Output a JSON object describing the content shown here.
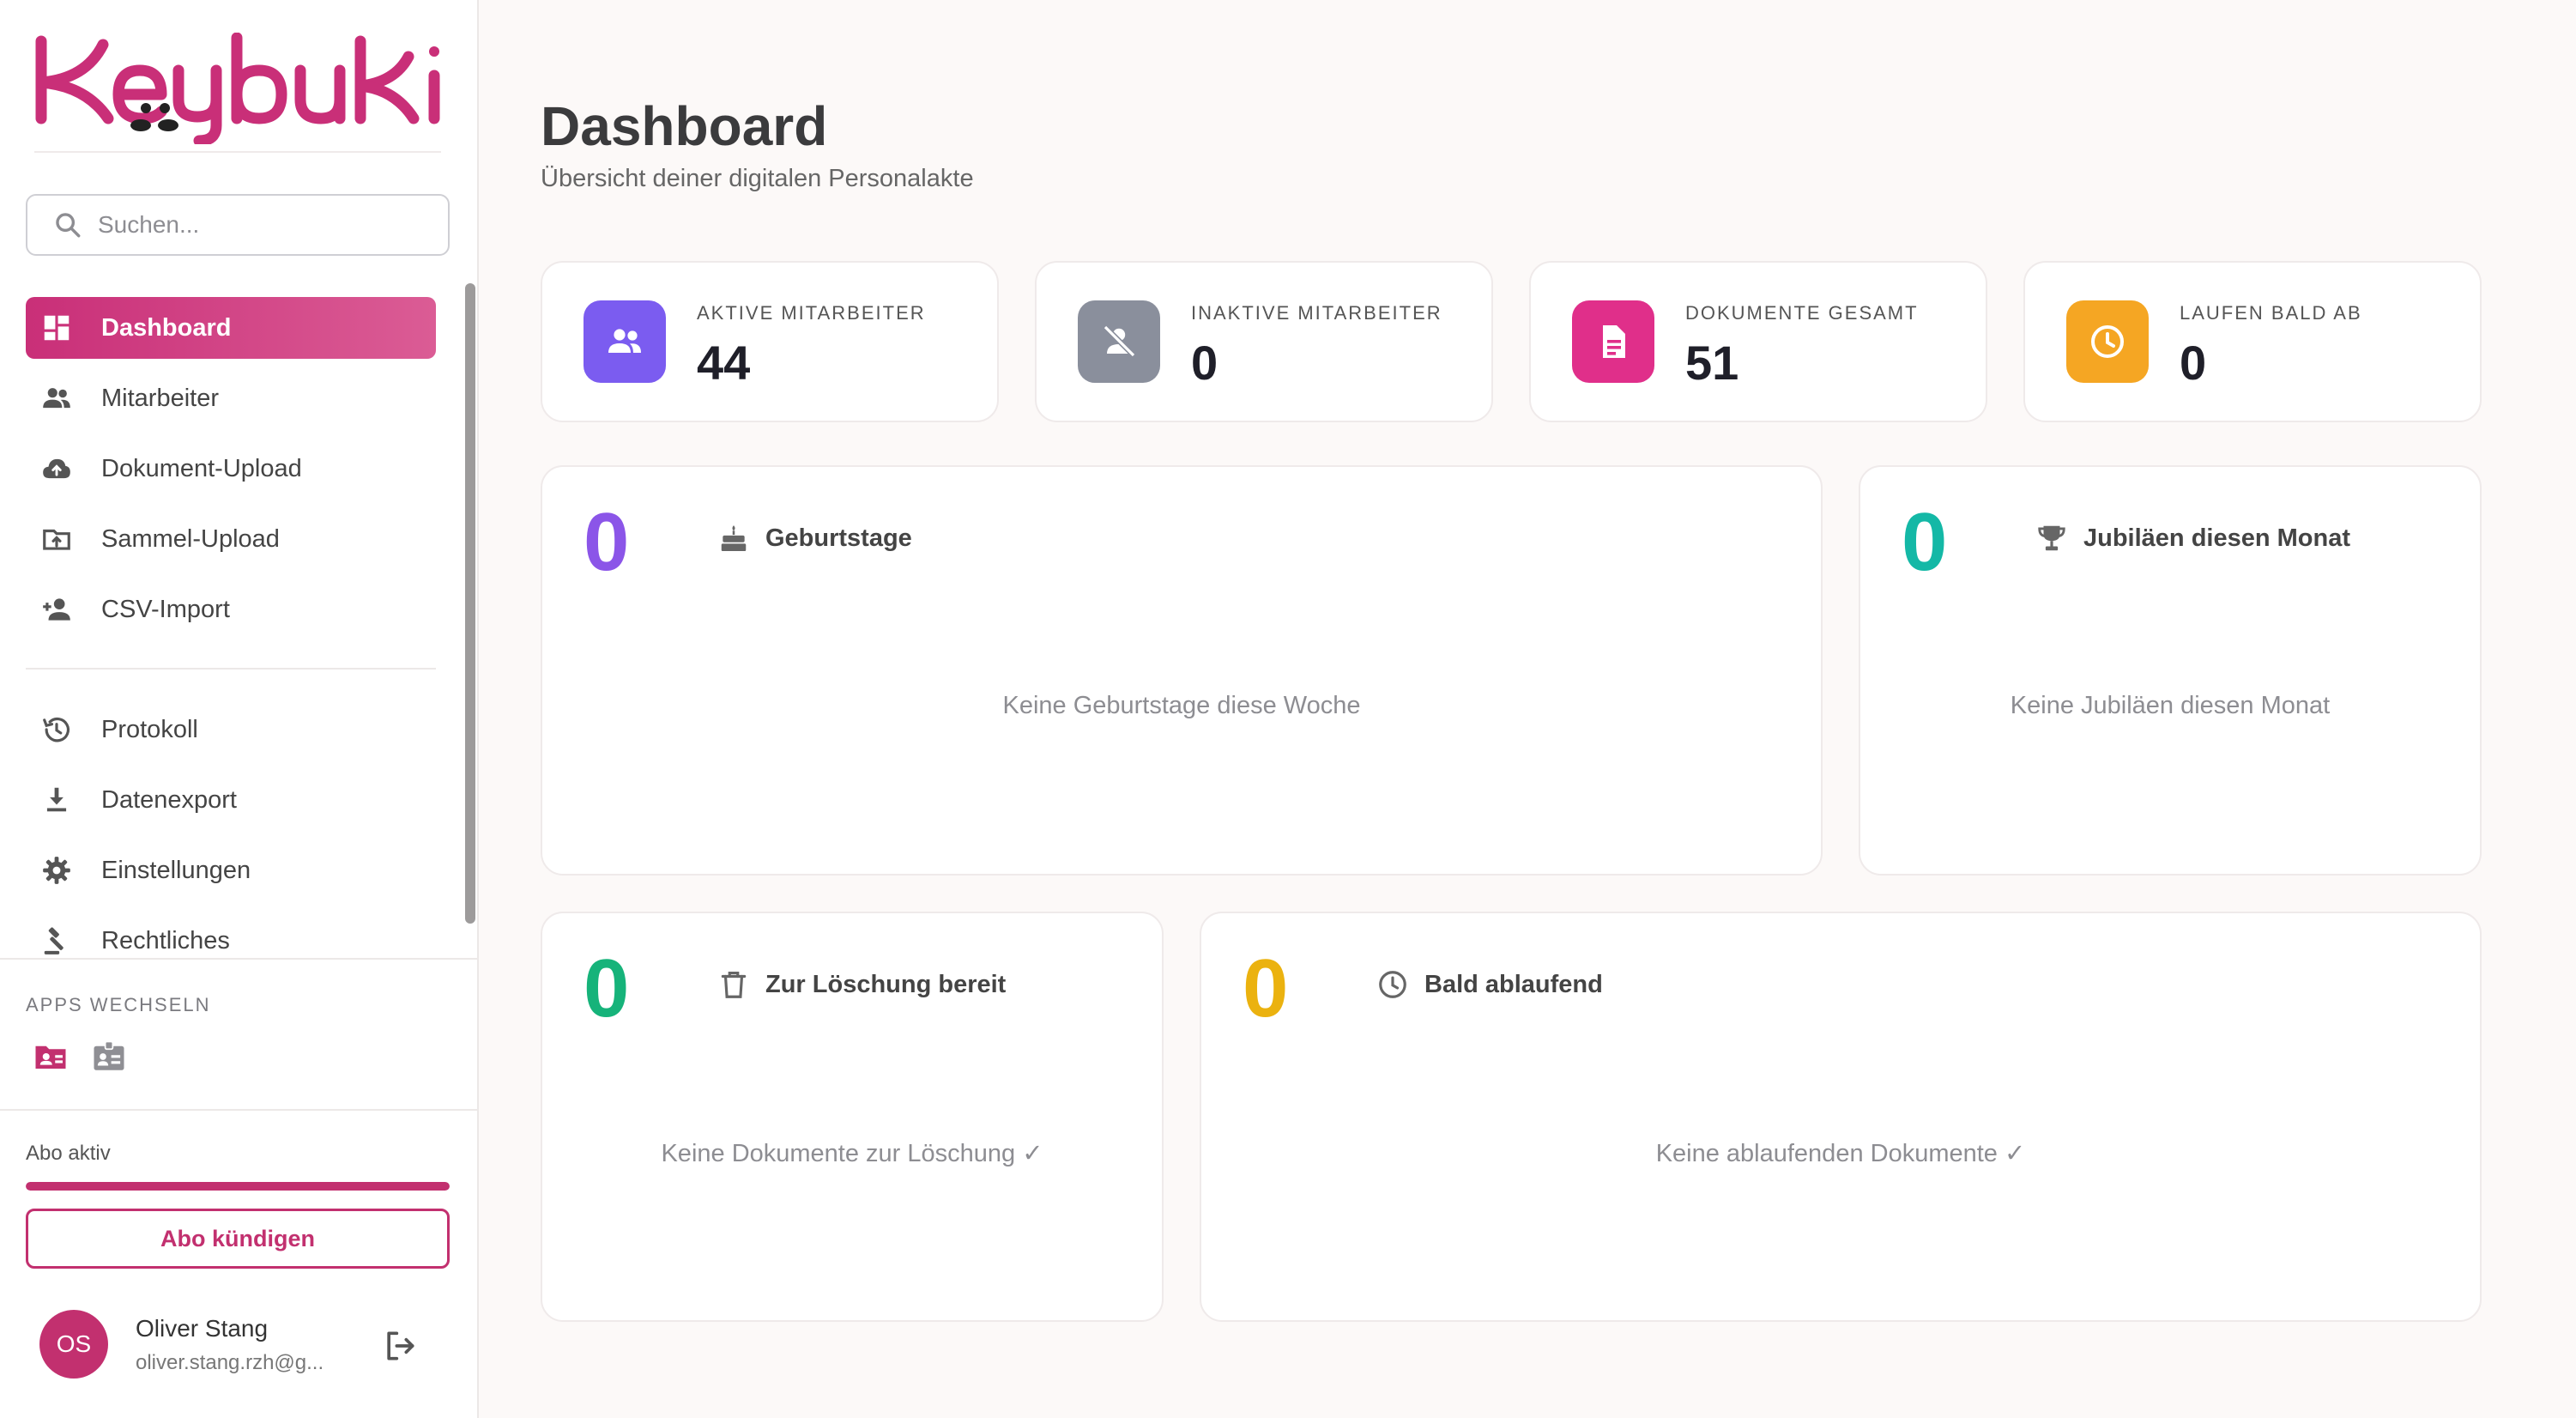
{
  "brand": {
    "logo_text": "Keybuki",
    "accent": "#c2306f"
  },
  "search": {
    "placeholder": "Suchen..."
  },
  "sidebar": {
    "primary": [
      {
        "label": "Dashboard",
        "icon": "dashboard-icon",
        "active": true
      },
      {
        "label": "Mitarbeiter",
        "icon": "people-icon"
      },
      {
        "label": "Dokument-Upload",
        "icon": "cloud-upload-icon"
      },
      {
        "label": "Sammel-Upload",
        "icon": "folder-upload-icon"
      },
      {
        "label": "CSV-Import",
        "icon": "person-add-icon"
      }
    ],
    "secondary": [
      {
        "label": "Protokoll",
        "icon": "history-icon"
      },
      {
        "label": "Datenexport",
        "icon": "download-icon"
      },
      {
        "label": "Einstellungen",
        "icon": "gear-icon"
      },
      {
        "label": "Rechtliches",
        "icon": "gavel-icon"
      }
    ],
    "apps_title": "APPS WECHSELN",
    "apps": [
      "folder-person-icon",
      "id-card-icon"
    ]
  },
  "subscription": {
    "label": "Abo aktiv",
    "progress": 1.0,
    "cancel_label": "Abo kündigen"
  },
  "user": {
    "initials": "OS",
    "name": "Oliver Stang",
    "email": "oliver.stang.rzh@g..."
  },
  "header": {
    "title": "Dashboard",
    "subtitle": "Übersicht deiner digitalen Personalakte"
  },
  "stats": [
    {
      "label": "AKTIVE MITARBEITER",
      "value": "44",
      "icon": "people-icon",
      "color": "#7b5cf0"
    },
    {
      "label": "INAKTIVE MITARBEITER",
      "value": "0",
      "icon": "person-off-icon",
      "color": "#8a8f9c"
    },
    {
      "label": "DOKUMENTE GESAMT",
      "value": "51",
      "icon": "document-icon",
      "color": "#e02f8a"
    },
    {
      "label": "LAUFEN BALD AB",
      "value": "0",
      "icon": "clock-icon",
      "color": "#f5a623"
    }
  ],
  "widgets": {
    "birthdays": {
      "count": "0",
      "title": "Geburtstage",
      "empty": "Keine Geburtstage diese Woche",
      "icon": "cake-icon",
      "color": "#8b55e8"
    },
    "anniversaries": {
      "count": "0",
      "title": "Jubiläen diesen Monat",
      "empty": "Keine Jubiläen diesen Monat",
      "icon": "trophy-icon",
      "color": "#14b8a6"
    },
    "deletion": {
      "count": "0",
      "title": "Zur Löschung bereit",
      "empty": "Keine Dokumente zur Löschung ✓",
      "icon": "trash-icon",
      "color": "#16b37a"
    },
    "expiring": {
      "count": "0",
      "title": "Bald ablaufend",
      "empty": "Keine ablaufenden Dokumente ✓",
      "icon": "clock-icon",
      "color": "#ebb20f"
    }
  }
}
